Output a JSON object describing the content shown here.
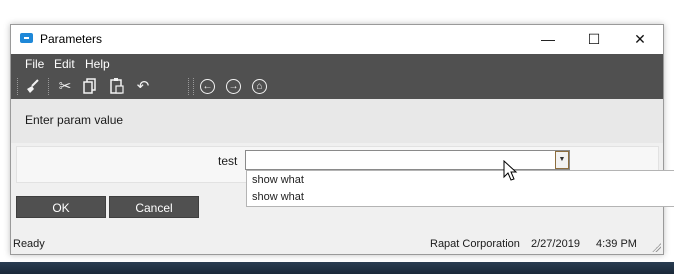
{
  "window": {
    "title": "Parameters"
  },
  "title_controls": {
    "minimize": "—",
    "maximize": "☐",
    "close": "✕"
  },
  "menu": {
    "items": [
      "File",
      "Edit",
      "Help"
    ]
  },
  "toolbar": {
    "icons": [
      "clear-brush-icon",
      "cut-icon",
      "copy-icon",
      "paste-icon",
      "undo-icon",
      "back-icon",
      "forward-icon",
      "home-icon"
    ]
  },
  "prompt": {
    "text": "Enter param value"
  },
  "param": {
    "label": "test",
    "value": "",
    "options": [
      "show what",
      "show what"
    ]
  },
  "buttons": {
    "ok": "OK",
    "cancel": "Cancel"
  },
  "status": {
    "state": "Ready",
    "company": "Rapat Corporation",
    "date": "2/27/2019",
    "time": "4:39 PM"
  },
  "colors": {
    "bar": "#505050",
    "accent": "#1e88d8"
  }
}
